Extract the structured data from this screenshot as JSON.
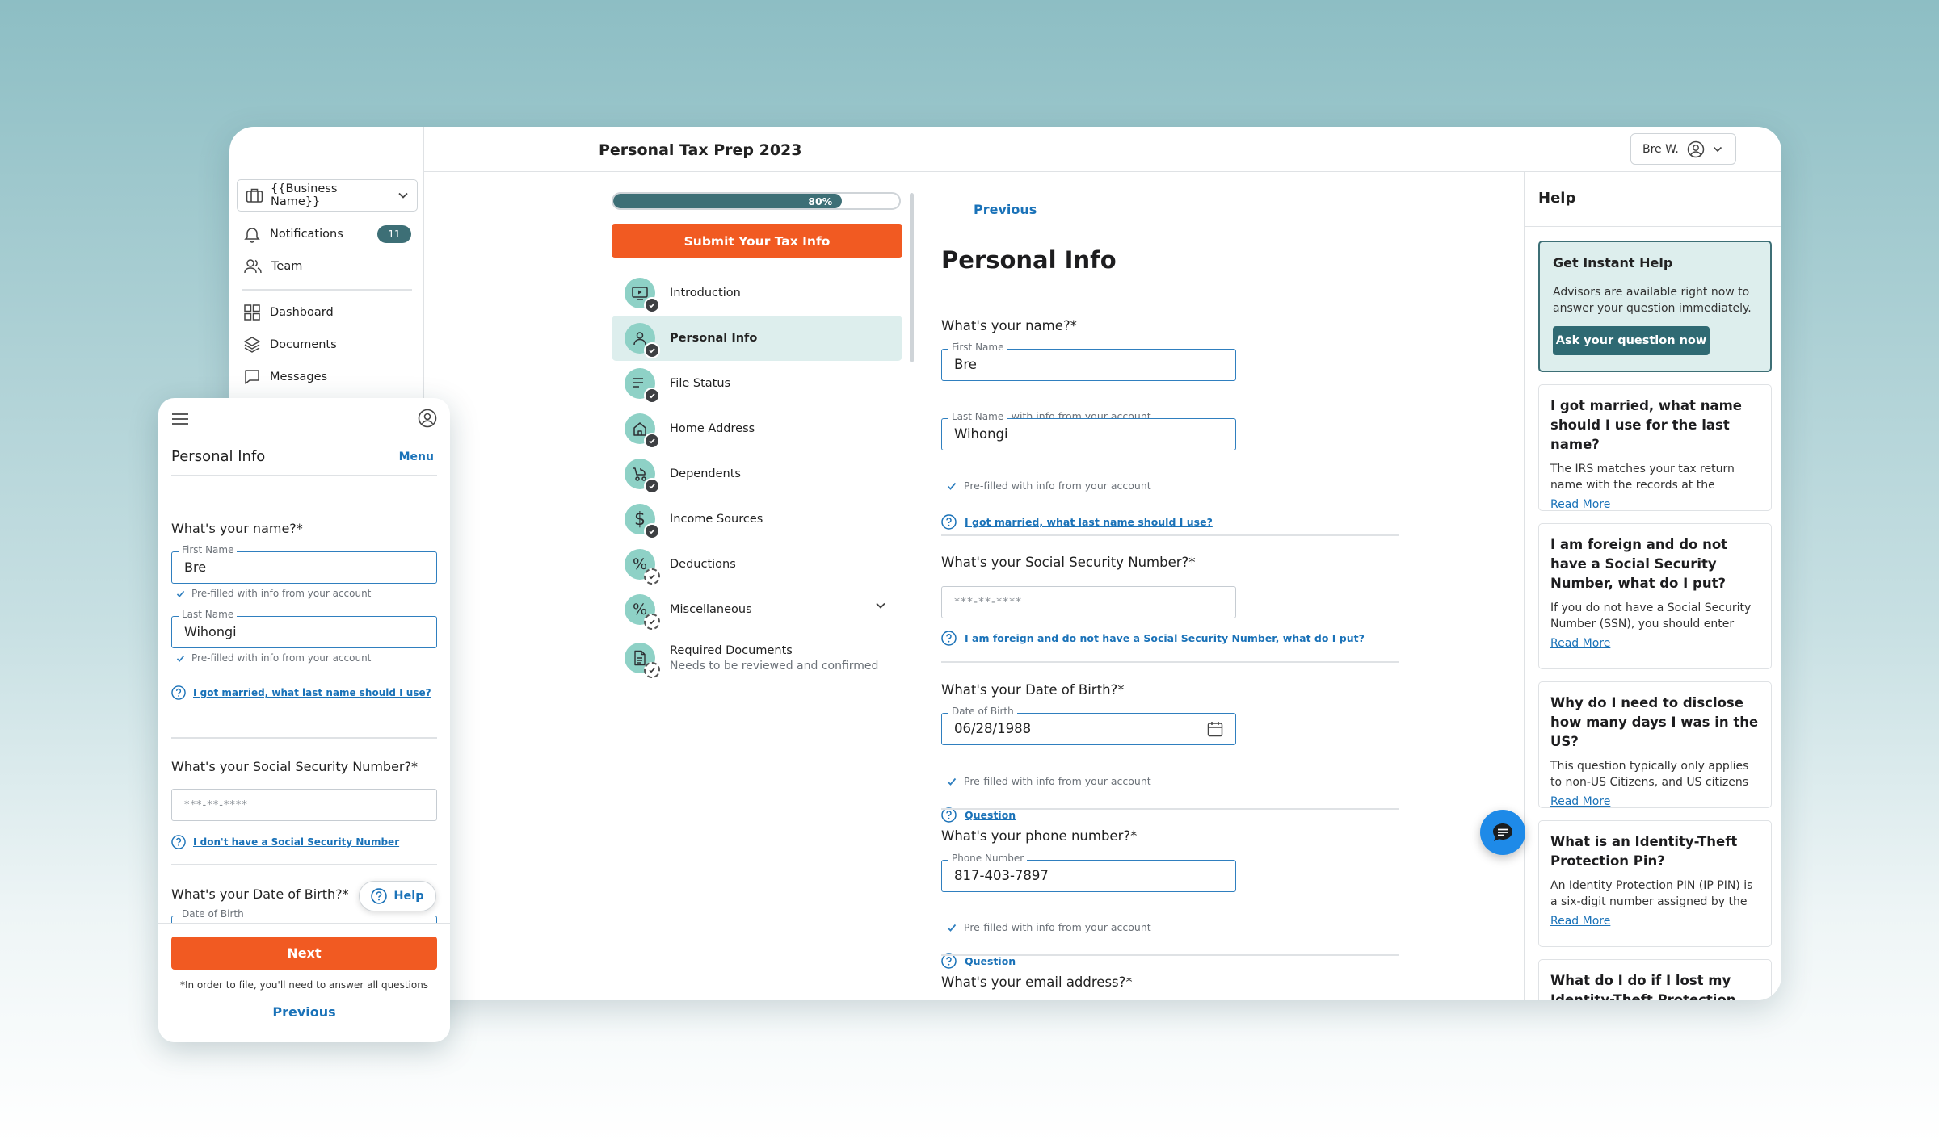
{
  "colors": {
    "accent": "#f15a22",
    "primary": "#3d6f76",
    "link": "#1a72b8",
    "step_bg": "#8ed1c6",
    "active_bg": "#ddeeed",
    "chat": "#1e8ae8"
  },
  "header": {
    "app_title": "Personal Tax Prep 2023",
    "user_name": "Bre W.",
    "user_icon": "user-circle-icon"
  },
  "sidebar": {
    "business_select": "{{Business Name}}",
    "items": [
      {
        "label": "Notifications",
        "icon": "bell-icon",
        "badge": "11"
      },
      {
        "label": "Team",
        "icon": "users-icon"
      },
      {
        "label": "Dashboard",
        "icon": "grid-icon"
      },
      {
        "label": "Documents",
        "icon": "layers-icon"
      },
      {
        "label": "Messages",
        "icon": "message-icon"
      }
    ]
  },
  "progress": {
    "percent": 80,
    "label": "80%"
  },
  "submit_label": "Submit Your Tax Info",
  "steps": [
    {
      "label": "Introduction",
      "icon": "video-icon",
      "status": "complete"
    },
    {
      "label": "Personal Info",
      "icon": "person-icon",
      "status": "complete",
      "active": true
    },
    {
      "label": "File Status",
      "icon": "list-icon",
      "status": "complete"
    },
    {
      "label": "Home Address",
      "icon": "home-icon",
      "status": "complete"
    },
    {
      "label": "Dependents",
      "icon": "stroller-icon",
      "status": "complete"
    },
    {
      "label": "Income Sources",
      "icon": "dollar-icon",
      "status": "complete"
    },
    {
      "label": "Deductions",
      "icon": "percent-icon",
      "status": "pending"
    },
    {
      "label": "Miscellaneous",
      "icon": "percent-icon",
      "status": "pending"
    },
    {
      "label": "Required Documents",
      "sub": "Needs to be reviewed and confirmed",
      "icon": "document-icon",
      "status": "pending"
    }
  ],
  "main": {
    "previous_label": "Previous",
    "page_title": "Personal Info",
    "name_question": "What's your name?*",
    "first_name_label": "First Name",
    "first_name_value": "Bre",
    "last_name_label": "Last Name",
    "last_name_value": "Wihongi",
    "prefilled_hint": "Pre-filled with info from your account",
    "married_link": "I got married, what last name should I use?",
    "ssn_question": "What's your Social Security Number?*",
    "ssn_placeholder": "***-**-****",
    "foreign_link": "I am foreign and do not have a Social Security Number, what do I put?",
    "dob_question": "What's your Date of Birth?*",
    "dob_label": "Date of Birth",
    "dob_value": "06/28/1988",
    "question_link": "Question",
    "phone_question": "What's your phone number?*",
    "phone_label": "Phone Number",
    "phone_value": "817-403-7897",
    "email_question": "What's your email address?*"
  },
  "help": {
    "title": "Help",
    "instant_title": "Get Instant Help",
    "instant_desc": "Advisors are available right now to answer your question immediately.",
    "instant_button": "Ask your question now",
    "read_more": "Read More",
    "faqs": [
      {
        "title": "I got married, what name should I use for the last name?",
        "desc": "The IRS matches your tax return name with the records at the Social…"
      },
      {
        "title": "I am foreign and do not have a Social Security Number, what do I put?",
        "desc": "If you do not have a Social Security Number (SSN), you should enter yo…"
      },
      {
        "title": "Why do I need to disclose how many days I was in the US?",
        "desc": "This question typically only applies to non-US Citizens, and US citizens l…"
      },
      {
        "title": "What is an Identity-Theft Protection Pin?",
        "desc": "An Identity Protection PIN (IP PIN) is a six-digit number assigned by the IR…"
      },
      {
        "title": "What do I do if I lost my Identity-Theft Protection Pin?",
        "desc": ""
      }
    ]
  },
  "mobile": {
    "title": "Personal Info",
    "menu_label": "Menu",
    "name_question": "What's your name?*",
    "first_name_label": "First Name",
    "first_name_value": "Bre",
    "last_name_label": "Last Name",
    "last_name_value": "Wihongi",
    "prefilled_hint": "Pre-filled with info from your account",
    "married_link": "I got married, what last name should I use?",
    "ssn_question": "What's your Social Security Number?*",
    "ssn_placeholder": "***-**-****",
    "no_ssn_link": "I don't have a Social Security Number",
    "dob_question": "What's your Date of Birth?*",
    "dob_label": "Date of Birth",
    "help_pill": "Help",
    "next_label": "Next",
    "footer_note": "*In order to file, you'll need to answer all questions",
    "previous_label": "Previous"
  }
}
